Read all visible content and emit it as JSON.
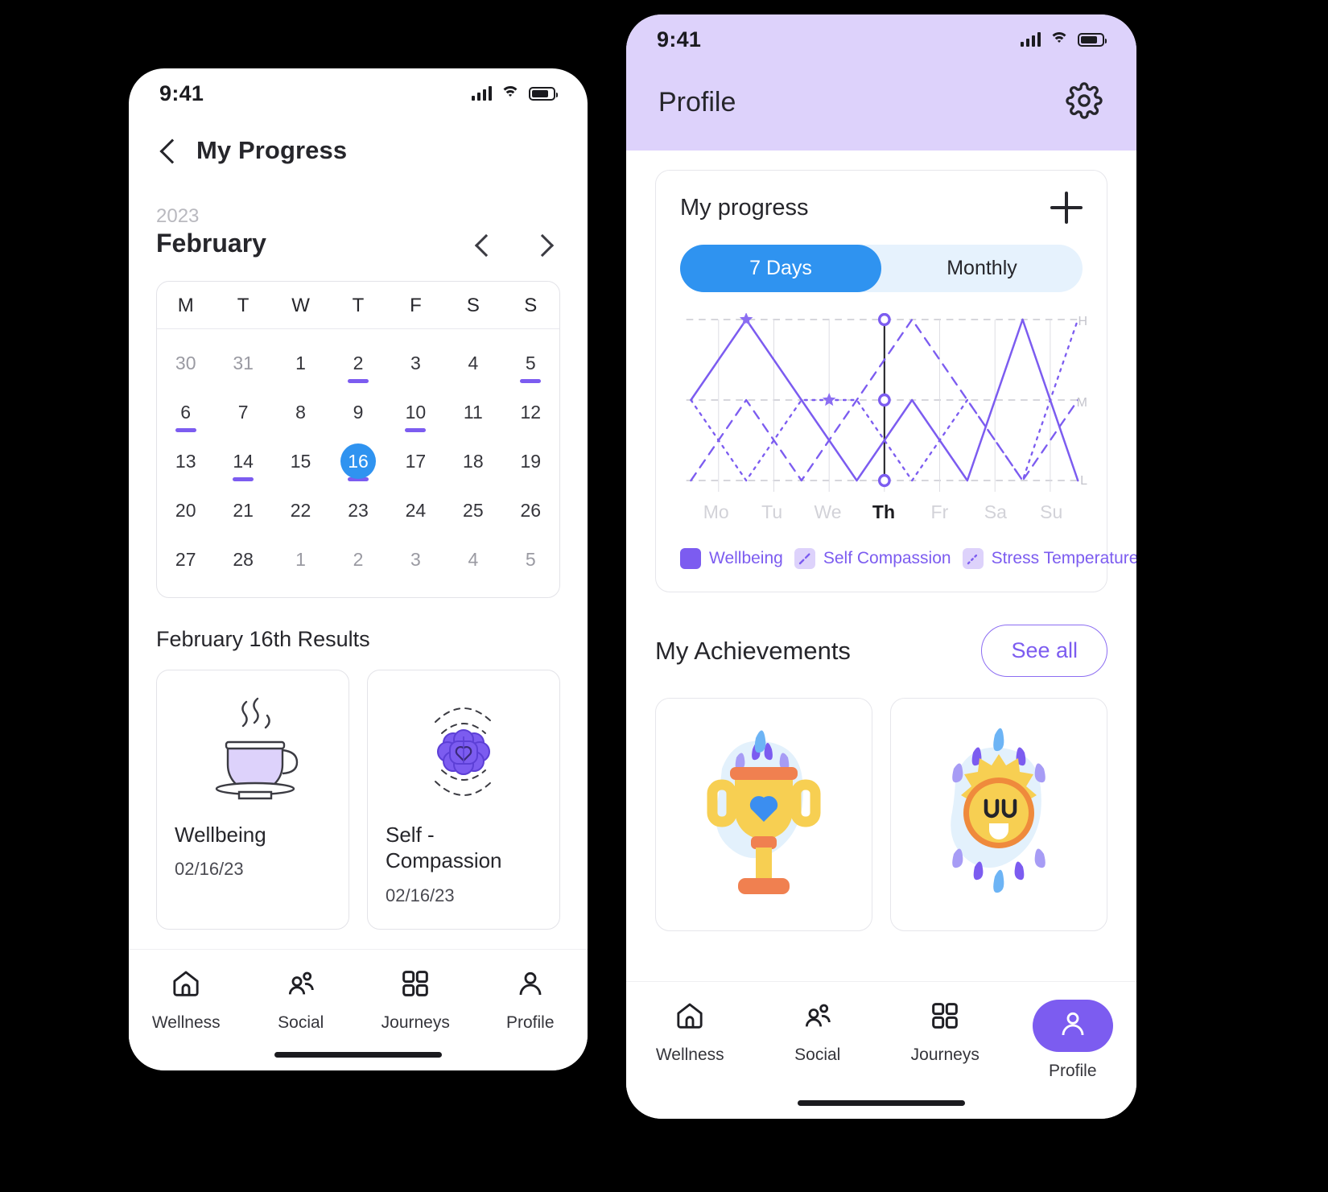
{
  "left_phone": {
    "status": {
      "time": "9:41",
      "signal_icon": "cellular-bars-icon",
      "wifi_icon": "wifi-icon",
      "battery_icon": "battery-icon"
    },
    "header": {
      "back_icon": "chevron-left-icon",
      "title": "My Progress"
    },
    "calendar": {
      "year": "2023",
      "month": "February",
      "prev_icon": "chevron-left-icon",
      "next_icon": "chevron-right-icon",
      "weekdays": [
        "M",
        "T",
        "W",
        "T",
        "F",
        "S",
        "S"
      ],
      "weeks": [
        [
          {
            "d": "30",
            "muted": true,
            "dot": false,
            "sel": false
          },
          {
            "d": "31",
            "muted": true,
            "dot": false,
            "sel": false
          },
          {
            "d": "1",
            "muted": false,
            "dot": false,
            "sel": false
          },
          {
            "d": "2",
            "muted": false,
            "dot": true,
            "sel": false
          },
          {
            "d": "3",
            "muted": false,
            "dot": false,
            "sel": false
          },
          {
            "d": "4",
            "muted": false,
            "dot": false,
            "sel": false
          },
          {
            "d": "5",
            "muted": false,
            "dot": true,
            "sel": false
          }
        ],
        [
          {
            "d": "6",
            "muted": false,
            "dot": true,
            "sel": false
          },
          {
            "d": "7",
            "muted": false,
            "dot": false,
            "sel": false
          },
          {
            "d": "8",
            "muted": false,
            "dot": false,
            "sel": false
          },
          {
            "d": "9",
            "muted": false,
            "dot": false,
            "sel": false
          },
          {
            "d": "10",
            "muted": false,
            "dot": true,
            "sel": false
          },
          {
            "d": "11",
            "muted": false,
            "dot": false,
            "sel": false
          },
          {
            "d": "12",
            "muted": false,
            "dot": false,
            "sel": false
          }
        ],
        [
          {
            "d": "13",
            "muted": false,
            "dot": false,
            "sel": false
          },
          {
            "d": "14",
            "muted": false,
            "dot": true,
            "sel": false
          },
          {
            "d": "15",
            "muted": false,
            "dot": false,
            "sel": false
          },
          {
            "d": "16",
            "muted": false,
            "dot": true,
            "sel": true
          },
          {
            "d": "17",
            "muted": false,
            "dot": false,
            "sel": false
          },
          {
            "d": "18",
            "muted": false,
            "dot": false,
            "sel": false
          },
          {
            "d": "19",
            "muted": false,
            "dot": false,
            "sel": false
          }
        ],
        [
          {
            "d": "20",
            "muted": false,
            "dot": false,
            "sel": false
          },
          {
            "d": "21",
            "muted": false,
            "dot": false,
            "sel": false
          },
          {
            "d": "22",
            "muted": false,
            "dot": false,
            "sel": false
          },
          {
            "d": "23",
            "muted": false,
            "dot": false,
            "sel": false
          },
          {
            "d": "24",
            "muted": false,
            "dot": false,
            "sel": false
          },
          {
            "d": "25",
            "muted": false,
            "dot": false,
            "sel": false
          },
          {
            "d": "26",
            "muted": false,
            "dot": false,
            "sel": false
          }
        ],
        [
          {
            "d": "27",
            "muted": false,
            "dot": false,
            "sel": false
          },
          {
            "d": "28",
            "muted": false,
            "dot": false,
            "sel": false
          },
          {
            "d": "1",
            "muted": true,
            "dot": false,
            "sel": false
          },
          {
            "d": "2",
            "muted": true,
            "dot": false,
            "sel": false
          },
          {
            "d": "3",
            "muted": true,
            "dot": false,
            "sel": false
          },
          {
            "d": "4",
            "muted": true,
            "dot": false,
            "sel": false
          },
          {
            "d": "5",
            "muted": true,
            "dot": false,
            "sel": false
          }
        ]
      ]
    },
    "results": {
      "heading": "February 16th  Results",
      "cards": [
        {
          "icon": "teacup-icon",
          "name": "Wellbeing",
          "date": "02/16/23"
        },
        {
          "icon": "brain-heart-icon",
          "name": "Self -\nCompassion",
          "date": "02/16/23"
        }
      ]
    },
    "tabbar": {
      "items": [
        {
          "icon": "home-icon",
          "label": "Wellness",
          "active": false
        },
        {
          "icon": "people-icon",
          "label": "Social",
          "active": false
        },
        {
          "icon": "grid-icon",
          "label": "Journeys",
          "active": false
        },
        {
          "icon": "person-icon",
          "label": "Profile",
          "active": false
        }
      ]
    }
  },
  "right_phone": {
    "status": {
      "time": "9:41",
      "signal_icon": "cellular-bars-icon",
      "wifi_icon": "wifi-icon",
      "battery_icon": "battery-icon"
    },
    "header": {
      "title": "Profile",
      "settings_icon": "gear-icon",
      "bg_color": "#ddd2fb"
    },
    "progress_card": {
      "title": "My progress",
      "add_icon": "plus-icon",
      "segments": [
        {
          "label": "7 Days",
          "active": true
        },
        {
          "label": "Monthly",
          "active": false
        }
      ]
    },
    "achievements": {
      "title": "My Achievements",
      "see_all_label": "See all",
      "cards": [
        {
          "icon": "trophy-heart-icon"
        },
        {
          "icon": "smiling-sun-icon"
        }
      ]
    },
    "tabbar": {
      "items": [
        {
          "icon": "home-icon",
          "label": "Wellness",
          "active": false
        },
        {
          "icon": "people-icon",
          "label": "Social",
          "active": false
        },
        {
          "icon": "grid-icon",
          "label": "Journeys",
          "active": false
        },
        {
          "icon": "person-icon",
          "label": "Profile",
          "active": true
        }
      ]
    }
  },
  "colors": {
    "accent_purple": "#7c5cf0",
    "accent_blue": "#2f93f0",
    "header_lavender": "#ddd2fb",
    "segment_track": "#e6f2fd",
    "text_dark": "#26262b",
    "muted": "#c4c4cc"
  },
  "chart_data": {
    "type": "line",
    "title": "My progress",
    "xlabel": "",
    "ylabel": "",
    "categories": [
      "Mo",
      "Tu",
      "We",
      "Th",
      "Fr",
      "Sa",
      "Su"
    ],
    "highlighted_category": "Th",
    "ytick_labels": [
      "H",
      "M",
      "L"
    ],
    "ylevels": {
      "H": 3,
      "M": 2,
      "L": 1
    },
    "ylim": [
      1,
      3
    ],
    "grid": true,
    "legend_position": "bottom",
    "series": [
      {
        "name": "Wellbeing",
        "style": "solid",
        "color": "#7c5cf0",
        "values": [
          2,
          3,
          2,
          1,
          2,
          1,
          3,
          1
        ]
      },
      {
        "name": "Self Compassion",
        "style": "dashed",
        "color": "#7c5cf0",
        "values": [
          1,
          2,
          1,
          2,
          3,
          2,
          1,
          2
        ]
      },
      {
        "name": "Stress Temperature",
        "style": "dotted",
        "color": "#7c5cf0",
        "values": [
          2,
          1,
          2,
          2,
          1,
          2,
          1,
          3
        ]
      }
    ],
    "legend": [
      {
        "label": "Wellbeing",
        "swatch": "solid"
      },
      {
        "label": "Self Compassion",
        "swatch": "dashed"
      },
      {
        "label": "Stress Temperature",
        "swatch": "dotted"
      }
    ]
  }
}
